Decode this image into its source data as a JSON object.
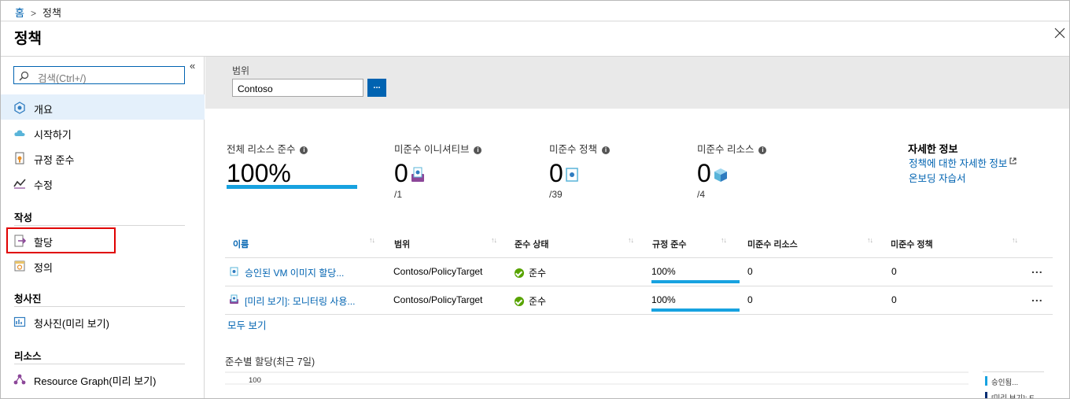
{
  "breadcrumb": {
    "home": "홈",
    "current": "정책"
  },
  "page": {
    "title": "정책"
  },
  "sidebar": {
    "search_placeholder": "검색(Ctrl+/)",
    "items": [
      {
        "label": "개요",
        "active": true
      },
      {
        "label": "시작하기"
      },
      {
        "label": "규정 준수"
      },
      {
        "label": "수정"
      }
    ],
    "sections": [
      {
        "title": "작성",
        "items": [
          {
            "label": "할당",
            "selected": true
          },
          {
            "label": "정의"
          }
        ]
      },
      {
        "title": "청사진",
        "items": [
          {
            "label": "청사진(미리 보기)"
          }
        ]
      },
      {
        "title": "리소스",
        "items": [
          {
            "label": "Resource Graph(미리 보기)"
          }
        ]
      }
    ]
  },
  "scope": {
    "label": "범위",
    "value": "Contoso",
    "button": "..."
  },
  "kpis": [
    {
      "label": "전체 리소스 준수",
      "value": "100%",
      "percent": 100
    },
    {
      "label": "미준수 이니셔티브",
      "value": "0",
      "sub": "/1"
    },
    {
      "label": "미준수 정책",
      "value": "0",
      "sub": "/39"
    },
    {
      "label": "미준수 리소스",
      "value": "0",
      "sub": "/4"
    }
  ],
  "more_info": {
    "title": "자세한 정보",
    "links": [
      "정책에 대한 자세한 정보",
      "온보딩 자습서"
    ]
  },
  "table": {
    "columns": [
      "이름",
      "범위",
      "준수 상태",
      "규정 준수",
      "미준수 리소스",
      "미준수 정책"
    ],
    "rows": [
      {
        "name": "승인된 VM 이미지 할당...",
        "scope": "Contoso/PolicyTarget",
        "status": "준수",
        "compliance": "100%",
        "percent": 100,
        "noncompliant_resources": "0",
        "noncompliant_policies": "0"
      },
      {
        "name": "[미리 보기]: 모니터링 사용...",
        "scope": "Contoso/PolicyTarget",
        "status": "준수",
        "compliance": "100%",
        "percent": 100,
        "noncompliant_resources": "0",
        "noncompliant_policies": "0"
      }
    ],
    "see_all": "모두 보기",
    "row_menu": "..."
  },
  "chart": {
    "title": "준수별 할당(최근 7일)",
    "y_tick": "100",
    "legend": [
      "승인됨...",
      "[미리 보기]: E"
    ],
    "legend_colors": [
      "#17a2e0",
      "#002d72"
    ]
  },
  "colors": {
    "accent": "#0063b1",
    "progress": "#17a2e0",
    "compliant": "#57a300",
    "selection": "#e00000"
  }
}
